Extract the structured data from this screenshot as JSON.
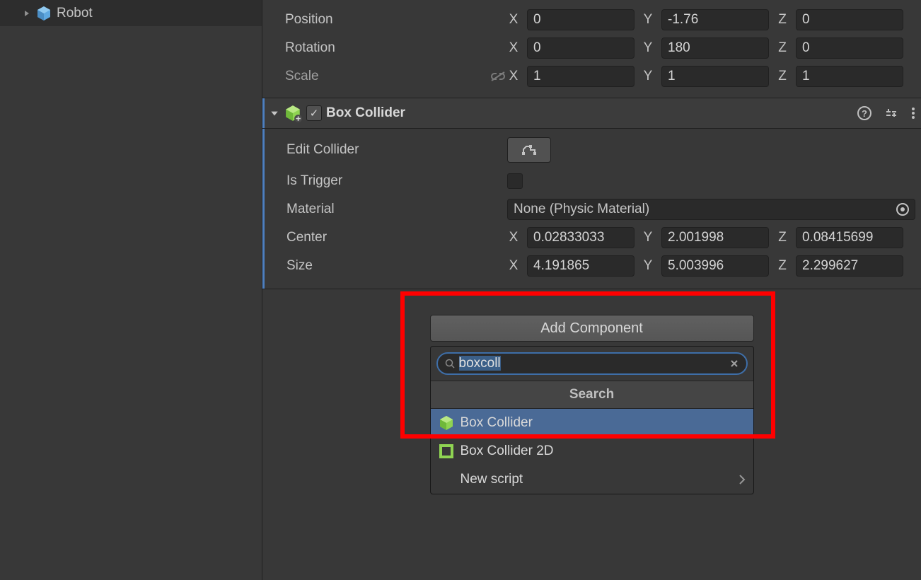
{
  "hierarchy": {
    "item_label": "Robot"
  },
  "transform": {
    "position_label": "Position",
    "rotation_label": "Rotation",
    "scale_label": "Scale",
    "x_label": "X",
    "y_label": "Y",
    "z_label": "Z",
    "position": {
      "x": "0",
      "y": "-1.76",
      "z": "0"
    },
    "rotation": {
      "x": "0",
      "y": "180",
      "z": "0"
    },
    "scale": {
      "x": "1",
      "y": "1",
      "z": "1"
    }
  },
  "box_collider": {
    "title": "Box Collider",
    "edit_label": "Edit Collider",
    "trigger_label": "Is Trigger",
    "material_label": "Material",
    "material_value": "None (Physic Material)",
    "center_label": "Center",
    "size_label": "Size",
    "center": {
      "x": "0.02833033",
      "y": "2.001998",
      "z": "0.08415699"
    },
    "size": {
      "x": "4.191865",
      "y": "5.003996",
      "z": "2.299627"
    }
  },
  "add_component": {
    "button_label": "Add Component",
    "search_value": "boxcoll",
    "search_header": "Search",
    "results": [
      {
        "label": "Box Collider",
        "icon": "cube-3d-icon"
      },
      {
        "label": "Box Collider 2D",
        "icon": "square-2d-icon"
      },
      {
        "label": "New script",
        "icon": "",
        "has_submenu": true
      }
    ]
  }
}
